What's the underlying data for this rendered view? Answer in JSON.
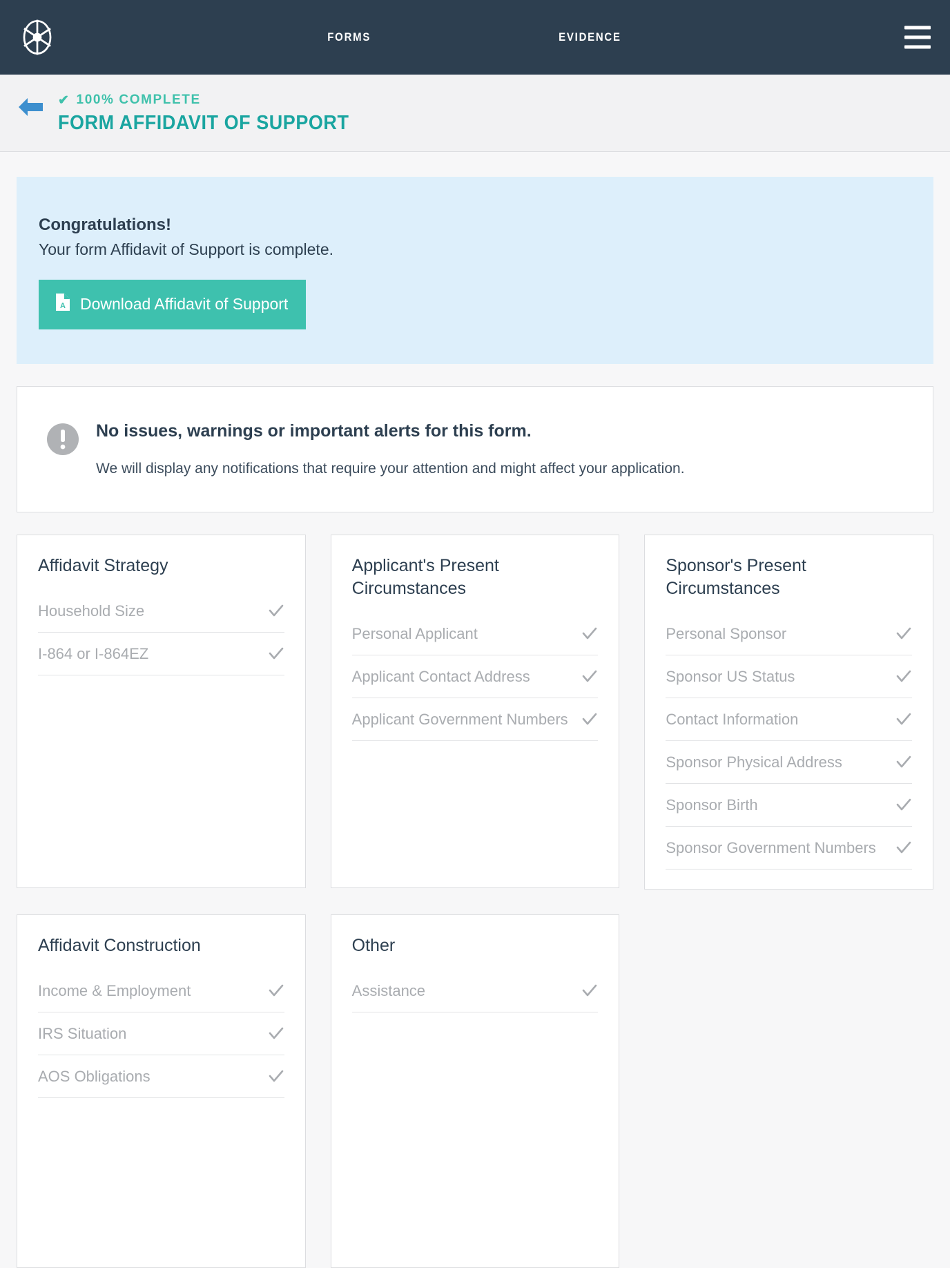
{
  "topbar": {
    "logo_icon": "ship-wheel-icon",
    "nav": [
      {
        "label": "FORMS"
      },
      {
        "label": "EVIDENCE"
      }
    ],
    "menu_icon": "hamburger-menu-icon"
  },
  "subheader": {
    "back_icon": "back-arrow-icon",
    "check_glyph": "✔",
    "progress": "100% COMPLETE",
    "title": "FORM AFFIDAVIT OF SUPPORT"
  },
  "congrats": {
    "heading": "Congratulations!",
    "message": "Your form Affidavit of Support is complete.",
    "button_label": "Download Affidavit of Support",
    "button_icon": "pdf-file-icon",
    "bg_color": "#ddeffb",
    "button_color": "#3ec1ae"
  },
  "alert": {
    "icon": "exclamation-circle-icon",
    "title": "No issues, warnings or important alerts for this form.",
    "body": "We will display any notifications that require your attention and might affect your application."
  },
  "cards": [
    {
      "title": "Affidavit Strategy",
      "items": [
        {
          "label": "Household Size",
          "complete": true
        },
        {
          "label": "I-864 or I-864EZ",
          "complete": true
        }
      ]
    },
    {
      "title": "Applicant's Present Circumstances",
      "items": [
        {
          "label": "Personal Applicant",
          "complete": true
        },
        {
          "label": "Applicant Contact Address",
          "complete": true
        },
        {
          "label": "Applicant Government Numbers",
          "complete": true
        }
      ]
    },
    {
      "title": "Sponsor's Present Circumstances",
      "items": [
        {
          "label": "Personal Sponsor",
          "complete": true
        },
        {
          "label": "Sponsor US Status",
          "complete": true
        },
        {
          "label": "Contact Information",
          "complete": true
        },
        {
          "label": "Sponsor Physical Address",
          "complete": true
        },
        {
          "label": "Sponsor Birth",
          "complete": true
        },
        {
          "label": "Sponsor Government Numbers",
          "complete": true
        }
      ]
    },
    {
      "title": "Affidavit Construction",
      "items": [
        {
          "label": "Income & Employment",
          "complete": true
        },
        {
          "label": "IRS Situation",
          "complete": true
        },
        {
          "label": "AOS Obligations",
          "complete": true
        }
      ]
    },
    {
      "title": "Other",
      "items": [
        {
          "label": "Assistance",
          "complete": true
        }
      ]
    }
  ],
  "colors": {
    "navy": "#2d3f50",
    "teal": "#1aa5a0",
    "mint": "#3ec1ae",
    "light_blue": "#ddeffb",
    "muted_grey": "#a9acb0"
  }
}
